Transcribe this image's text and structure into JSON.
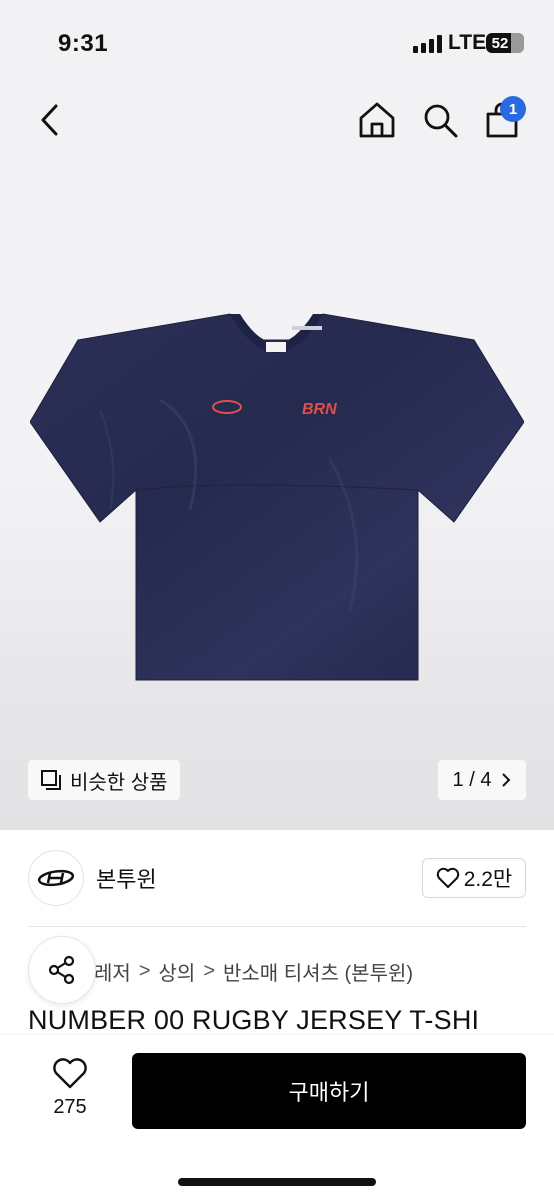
{
  "status_bar": {
    "time": "9:31",
    "network": "LTE",
    "battery": "52"
  },
  "nav": {
    "back_icon": "chevron-left-icon",
    "home_icon": "home-icon",
    "search_icon": "search-icon",
    "cart_icon": "shopping-bag-icon",
    "cart_count": "1"
  },
  "product_image": {
    "similar_label": "비슷한 상품",
    "page_indicator": "1 / 4",
    "chest_logo_text": "BRN"
  },
  "brand": {
    "name": "본투윈",
    "likes": "2.2만"
  },
  "breadcrumb": [
    "레저",
    "상의",
    "반소매 티셔츠 (본투윈)"
  ],
  "product": {
    "title": "NUMBER 00 RUGBY JERSEY T-SHI"
  },
  "bottom_bar": {
    "wish_count": "275",
    "buy_label": "구매하기"
  },
  "colors": {
    "accent": "#2a6ae0",
    "jersey": "#262a4f",
    "print": "#e0504a",
    "buy_button": "#000000"
  }
}
